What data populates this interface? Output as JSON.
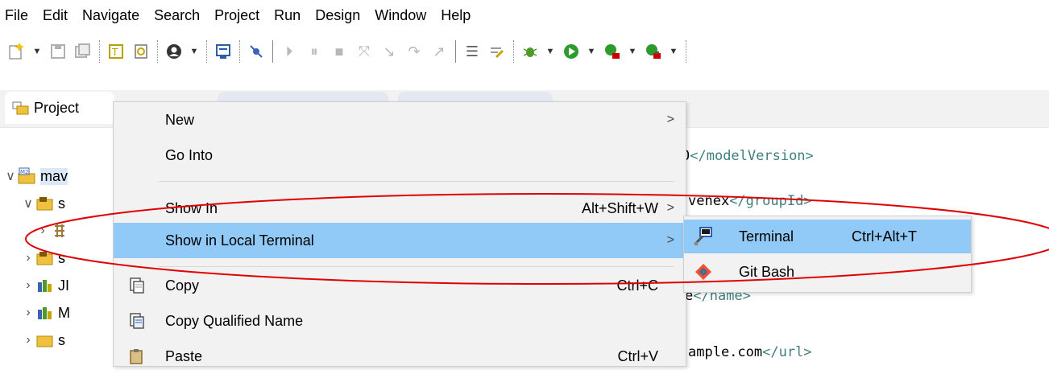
{
  "menubar": {
    "items": [
      "File",
      "Edit",
      "Navigate",
      "Search",
      "Project",
      "Run",
      "Design",
      "Window",
      "Help"
    ]
  },
  "toolbar": {
    "icons": [
      "new-wizard-icon",
      "save-icon",
      "save-all-icon",
      "open-type-icon",
      "open-resource-icon",
      "user-icon",
      "console-icon",
      "skip-breakpoints-icon",
      "resume-icon",
      "suspend-icon",
      "terminate-icon",
      "disconnect-icon",
      "step-into-icon",
      "step-over-icon",
      "step-return-icon",
      "use-step-filters-icon",
      "drop-to-frame-icon",
      "debug-icon",
      "run-icon",
      "run-coverage-icon",
      "external-tools-icon"
    ]
  },
  "tabs": {
    "project_explorer": "Project"
  },
  "tree": {
    "items": [
      {
        "label": "mav",
        "icon": "maven-project-icon"
      },
      {
        "label": "s",
        "icon": "source-folder-icon"
      },
      {
        "label": "",
        "icon": "package-icon"
      },
      {
        "label": "s",
        "icon": "source-folder-icon"
      },
      {
        "label": "JI",
        "icon": "library-icon"
      },
      {
        "label": "M",
        "icon": "library-icon"
      },
      {
        "label": "s",
        "icon": "folder-icon"
      }
    ]
  },
  "editor": {
    "lines": [
      {
        "text": "0",
        "tag": "</modelVersion>"
      },
      {
        "text": "venex",
        "tag": "</groupId>"
      },
      {
        "text": "e",
        "tag": "</name>"
      },
      {
        "text": "ample.com",
        "tag": "</url>"
      }
    ]
  },
  "context_menu": {
    "items": [
      {
        "label": "New",
        "shortcut": "",
        "submenu": true
      },
      {
        "label": "Go Into",
        "shortcut": "",
        "submenu": false
      },
      {
        "label": "Show In",
        "shortcut": "Alt+Shift+W",
        "submenu": true
      },
      {
        "label": "Show in Local Terminal",
        "shortcut": "",
        "submenu": true
      },
      {
        "label": "Copy",
        "shortcut": "Ctrl+C",
        "submenu": false,
        "icon": "copy-icon"
      },
      {
        "label": "Copy Qualified Name",
        "shortcut": "",
        "submenu": false,
        "icon": "copy-qualified-name-icon"
      },
      {
        "label": "Paste",
        "shortcut": "Ctrl+V",
        "submenu": false,
        "icon": "paste-icon"
      }
    ],
    "arrow": ">"
  },
  "submenu": {
    "items": [
      {
        "label": "Terminal",
        "shortcut": "Ctrl+Alt+T",
        "icon": "terminal-icon"
      },
      {
        "label": "Git Bash",
        "shortcut": "",
        "icon": "git-bash-icon"
      }
    ]
  },
  "colors": {
    "highlight": "#91c9f7",
    "menu_bg": "#f2f2f2",
    "annotation": "#e00000",
    "xml_tag": "#3f7f7f"
  }
}
